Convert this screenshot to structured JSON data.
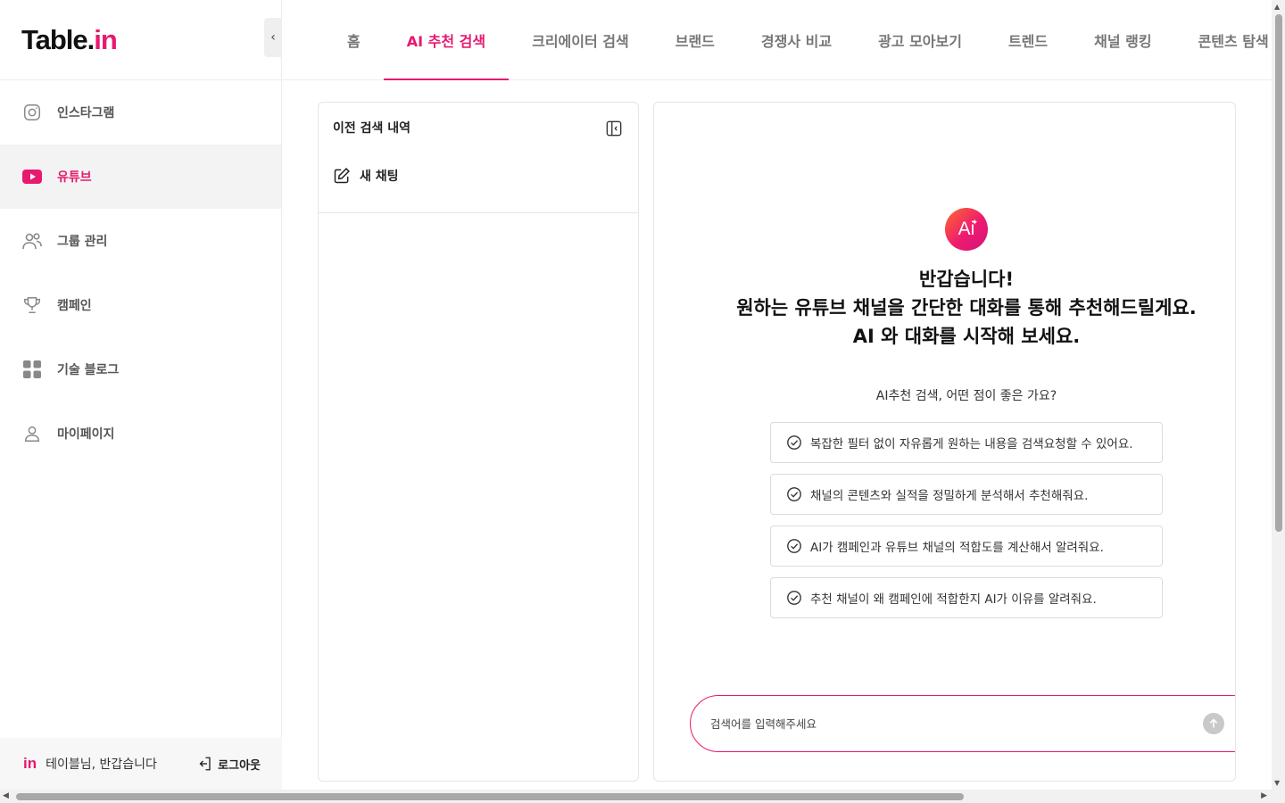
{
  "brand": {
    "logo_main": "Table.",
    "logo_accent": "in",
    "accent_color": "#e8196e"
  },
  "sidebar": {
    "collapse_icon": "chevron-left-icon",
    "items": [
      {
        "label": "인스타그램",
        "icon": "instagram-icon"
      },
      {
        "label": "유튜브",
        "icon": "youtube-icon"
      },
      {
        "label": "그룹 관리",
        "icon": "users-icon"
      },
      {
        "label": "캠페인",
        "icon": "trophy-icon"
      },
      {
        "label": "기술 블로그",
        "icon": "grid-icon"
      },
      {
        "label": "마이페이지",
        "icon": "user-icon"
      }
    ],
    "active_item": "유튜브",
    "footer": {
      "logo": "in",
      "greeting": "테이블님, 반갑습니다",
      "logout": "로그아웃"
    }
  },
  "tabs": [
    "홈",
    "AI 추천 검색",
    "크리에이터 검색",
    "브랜드",
    "경쟁사 비교",
    "광고 모아보기",
    "트렌드",
    "채널 랭킹",
    "콘텐츠 탐색"
  ],
  "active_tab": "AI 추천 검색",
  "history": {
    "title": "이전 검색 내역",
    "new_chat": "새 채팅"
  },
  "chat": {
    "ai_badge": "Ai",
    "greeting_line1": "반갑습니다!",
    "greeting_line2": "원하는 유튜브 채널을 간단한 대화를 통해 추천해드릴게요.",
    "greeting_line3": "AI 와 대화를 시작해 보세요.",
    "features_title": "AI추천 검색, 어떤 점이 좋은 가요?",
    "features": [
      "복잡한 필터 없이 자유롭게 원하는 내용을 검색요청할 수 있어요.",
      "채널의 콘텐츠와 실적을 정밀하게 분석해서 추천해줘요.",
      "AI가 캠페인과 유튜브 채널의 적합도를 계산해서 알려줘요.",
      "추천 채널이 왜 캠페인에 적합한지 AI가 이유를 알려줘요."
    ],
    "search_placeholder": "검색어를 입력해주세요",
    "search_value": ""
  }
}
